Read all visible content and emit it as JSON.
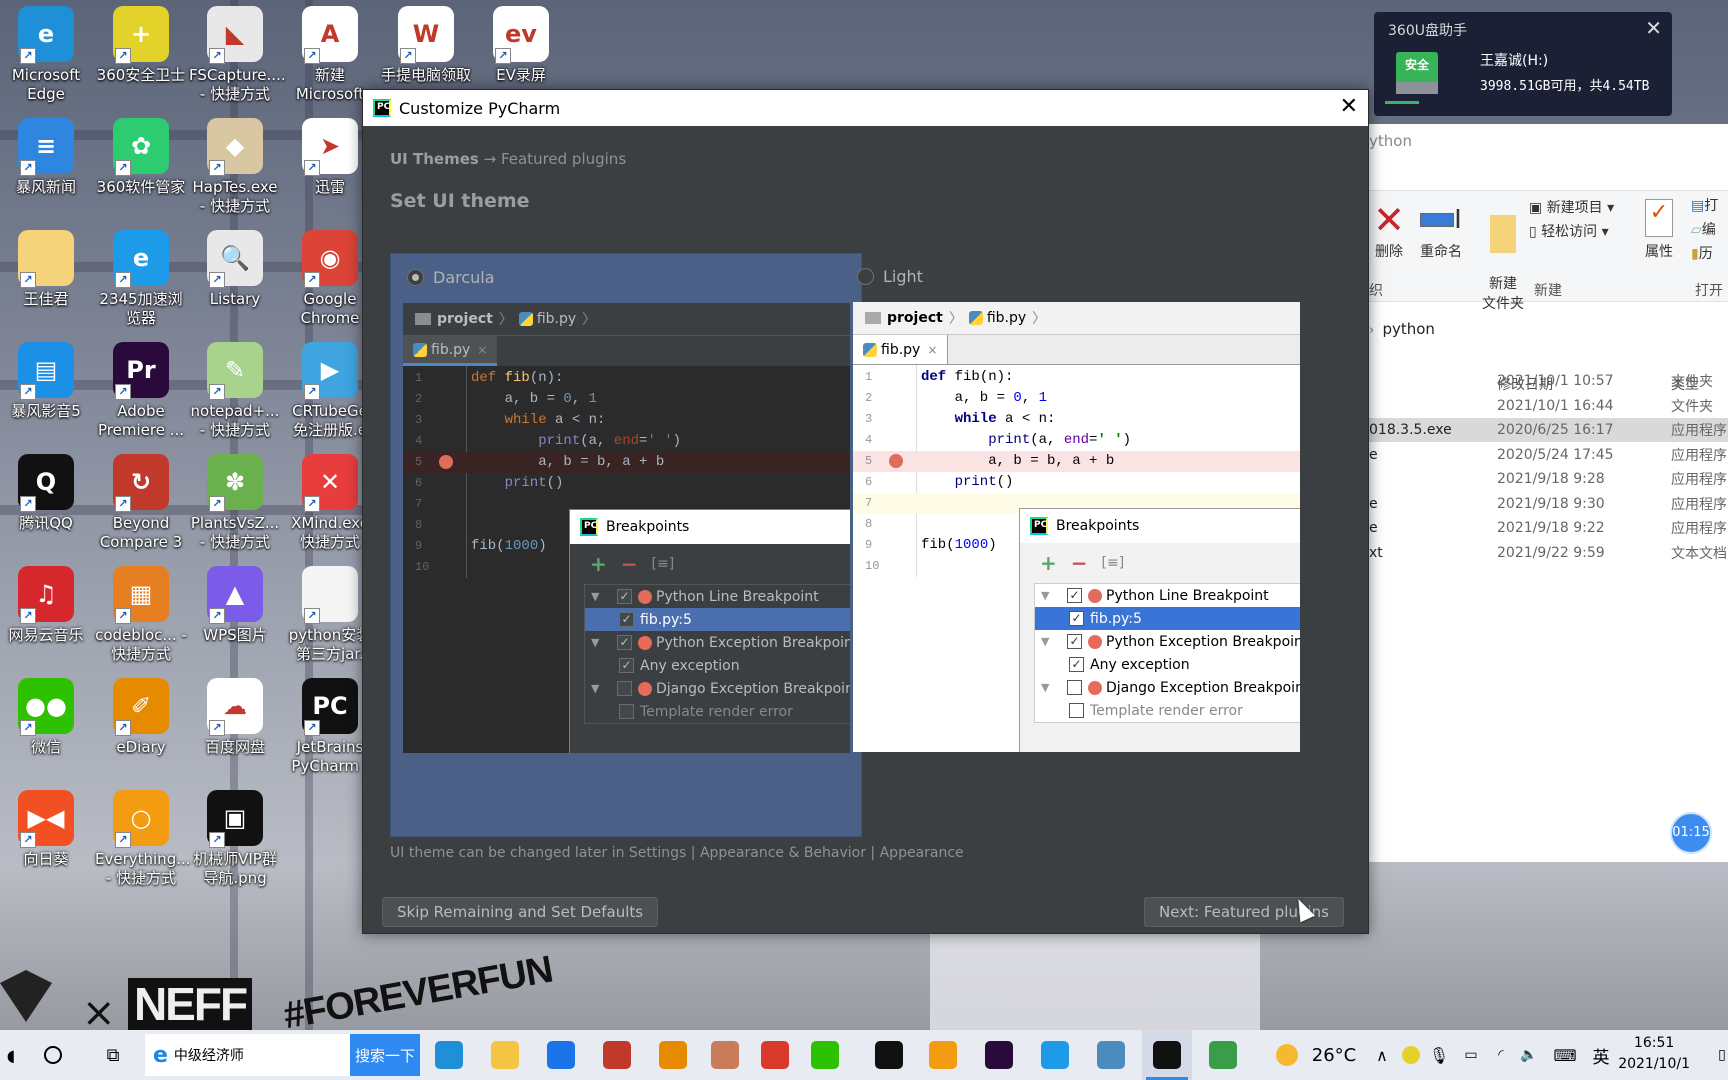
{
  "desktop": {
    "icons": [
      {
        "label": "Microsoft Edge",
        "icon": "edge-icon",
        "color": "#1f8fd8",
        "glyph": "e"
      },
      {
        "label": "360安全卫士",
        "icon": "360-safe-icon",
        "color": "#e3d22a",
        "glyph": "+"
      },
      {
        "label": "FSCapture.... - 快捷方式",
        "icon": "fscapture-icon",
        "color": "#e8e8e8",
        "glyph": "◣"
      },
      {
        "label": "新建 Microsoft",
        "icon": "access-file-icon",
        "color": "#ffffff",
        "glyph": "A"
      },
      {
        "label": "手提电脑领取",
        "icon": "word-doc-icon",
        "color": "#ffffff",
        "glyph": "W"
      },
      {
        "label": "EV录屏",
        "icon": "ev-recorder-icon",
        "color": "#ffffff",
        "glyph": "ev"
      },
      {
        "label": "暴风新闻",
        "icon": "baofeng-news-icon",
        "color": "#2e86de",
        "glyph": "≡"
      },
      {
        "label": "360软件管家",
        "icon": "360-software-icon",
        "color": "#2ecc71",
        "glyph": "✿"
      },
      {
        "label": "HapTes.exe - 快捷方式",
        "icon": "haptes-icon",
        "color": "#d9c7a3",
        "glyph": "◆"
      },
      {
        "label": "迅雷",
        "icon": "xunlei-icon",
        "color": "#ffffff",
        "glyph": "➤"
      },
      {
        "label": "王佳君",
        "icon": "folder-icon",
        "color": "#f4d37a",
        "glyph": ""
      },
      {
        "label": "2345加速浏览器",
        "icon": "2345-browser-icon",
        "color": "#1e9be8",
        "glyph": "e"
      },
      {
        "label": "Listary",
        "icon": "listary-icon",
        "color": "#e8e8e8",
        "glyph": "🔍"
      },
      {
        "label": "Google Chrome",
        "icon": "chrome-icon",
        "color": "#db4437",
        "glyph": "◉"
      },
      {
        "label": "暴风影音5",
        "icon": "baofeng-player-icon",
        "color": "#1c8fe6",
        "glyph": "▤"
      },
      {
        "label": "Adobe Premiere ...",
        "icon": "premiere-icon",
        "color": "#2a0a3a",
        "glyph": "Pr"
      },
      {
        "label": "notepad+... - 快捷方式",
        "icon": "notepadpp-icon",
        "color": "#a8d38c",
        "glyph": "✎"
      },
      {
        "label": "CRTubeGe 免注册版.e",
        "icon": "crtube-icon",
        "color": "#3fa4e0",
        "glyph": "▶"
      },
      {
        "label": "腾讯QQ",
        "icon": "qq-icon",
        "color": "#111111",
        "glyph": "Q"
      },
      {
        "label": "Beyond Compare 3",
        "icon": "beyond-compare-icon",
        "color": "#c0392b",
        "glyph": "↻"
      },
      {
        "label": "PlantsVsZ... - 快捷方式",
        "icon": "pvz-icon",
        "color": "#6ab04c",
        "glyph": "✽"
      },
      {
        "label": "XMind.exe 快捷方式",
        "icon": "xmind-icon",
        "color": "#e83d3d",
        "glyph": "✕"
      },
      {
        "label": "网易云音乐",
        "icon": "netease-music-icon",
        "color": "#d6282c",
        "glyph": "♫"
      },
      {
        "label": "codebloc... - 快捷方式",
        "icon": "codeblocks-icon",
        "color": "#e67e22",
        "glyph": "▦"
      },
      {
        "label": "WPS图片",
        "icon": "wps-pic-icon",
        "color": "#7b5ce8",
        "glyph": "▲"
      },
      {
        "label": "python安装 第三方jar.",
        "icon": "text-file-icon",
        "color": "#f5f5f5",
        "glyph": ""
      },
      {
        "label": "微信",
        "icon": "wechat-icon",
        "color": "#2dc100",
        "glyph": "●●"
      },
      {
        "label": "eDiary",
        "icon": "ediary-icon",
        "color": "#e68a00",
        "glyph": "✐"
      },
      {
        "label": "百度网盘",
        "icon": "baidu-pan-icon",
        "color": "#ffffff",
        "glyph": "☁"
      },
      {
        "label": "JetBrains PyCharm .",
        "icon": "pycharm-icon",
        "color": "#111111",
        "glyph": "PC"
      },
      {
        "label": "向日葵",
        "icon": "sunlogin-icon",
        "color": "#f25022",
        "glyph": "▶◀"
      },
      {
        "label": "Everything... - 快捷方式",
        "icon": "everything-icon",
        "color": "#f39c12",
        "glyph": "○"
      },
      {
        "label": "机械师VIP群 导航.png",
        "icon": "image-file-icon",
        "color": "#111111",
        "glyph": "▣"
      }
    ],
    "wallpaper_text": {
      "brand_x": "×",
      "brand": "NEFF",
      "hashtag": "#FOREVERFUN"
    }
  },
  "dialog": {
    "title": "Customize PyCharm",
    "breadcrumb_current": "UI Themes",
    "breadcrumb_arrow": "→",
    "breadcrumb_next": "Featured plugins",
    "heading": "Set UI theme",
    "themes": [
      {
        "name": "Darcula",
        "selected": true
      },
      {
        "name": "Light",
        "selected": false
      }
    ],
    "preview": {
      "nav_project": "project",
      "nav_file": "fib.py",
      "tab_file": "fib.py",
      "tab_close": "×",
      "line_numbers": [
        "1",
        "2",
        "3",
        "4",
        "5",
        "6",
        "7",
        "8",
        "9",
        "10"
      ],
      "code": {
        "l1_kw": "def",
        "l1_fn": "fib",
        "l1_rest": "(n):",
        "l2_a": "    a, b = ",
        "l2_n0": "0",
        "l2_c": ", ",
        "l2_n1": "1",
        "l3_kw": "    while",
        "l3_rest": " a < n:",
        "l4_bi": "        print",
        "l4_a": "(a, ",
        "l4_kw": "end",
        "l4_eq": "=",
        "l4_str": "' '",
        "l4_end": ")",
        "l5": "        a, b = b, a + b",
        "l6_bi": "    print",
        "l6_rest": "()",
        "l9_a": "fib(",
        "l9_num": "1000",
        "l9_b": ")"
      },
      "breakpoint_line": 5,
      "breakpoints_window": {
        "title": "Breakpoints",
        "add": "+",
        "remove": "−",
        "copy": "[≡]",
        "items": [
          {
            "label": "Python Line Breakpoint",
            "checked": true,
            "level": 0,
            "expander": "▼"
          },
          {
            "label": "fib.py:5",
            "checked": true,
            "level": 1,
            "selected": true
          },
          {
            "label": "Python Exception Breakpoint",
            "checked": true,
            "level": 0,
            "expander": "▼"
          },
          {
            "label": "Any exception",
            "checked": true,
            "level": 1
          },
          {
            "label": "Django Exception Breakpoint",
            "checked": false,
            "level": 0,
            "expander": "▼"
          },
          {
            "label": "Template render error",
            "checked": false,
            "level": 1
          }
        ]
      }
    },
    "hint": "UI theme can be changed later in Settings | Appearance & Behavior | Appearance",
    "skip_button": "Skip Remaining and Set Defaults",
    "next_button": "Next: Featured plugins",
    "close": "✕"
  },
  "usb_popup": {
    "title": "360U盘助手",
    "badge": "安全",
    "drive_name": "王嘉诚(H:)",
    "capacity": "3998.51GB可用，共4.54TB",
    "close": "✕"
  },
  "explorer": {
    "title_partial": "ython",
    "ribbon": {
      "delete": "删除",
      "rename": "重命名",
      "new_folder": "新建\n文件夹",
      "new_item": "新建项目 ▾",
      "easy_access": "轻松访问 ▾",
      "properties": "属性",
      "open_partial": "打",
      "edit_partial": "编",
      "history_partial": "历",
      "group_organize_partial": "织",
      "group_new": "新建",
      "group_open": "打开"
    },
    "address": "python",
    "columns": {
      "modified": "修改日期",
      "type": "类型"
    },
    "rows": [
      {
        "name": "",
        "modified": "2021/10/1 10:57",
        "type": "文件夹"
      },
      {
        "name": "",
        "modified": "2021/10/1 16:44",
        "type": "文件夹"
      },
      {
        "name": "018.3.5.exe",
        "modified": "2020/6/25 16:17",
        "type": "应用程序",
        "highlight": true
      },
      {
        "name": "e",
        "modified": "2020/5/24 17:45",
        "type": "应用程序"
      },
      {
        "name": "",
        "modified": "2021/9/18 9:28",
        "type": "应用程序"
      },
      {
        "name": "e",
        "modified": "2021/9/18 9:30",
        "type": "应用程序"
      },
      {
        "name": "e",
        "modified": "2021/9/18 9:22",
        "type": "应用程序"
      },
      {
        "name": "xt",
        "modified": "2021/9/22 9:59",
        "type": "文本文档"
      }
    ]
  },
  "timer_badge": "01:15",
  "taskbar": {
    "search_text": "中级经济师",
    "search_button": "搜索一下",
    "apps": [
      {
        "name": "edge",
        "color": "#1f8fd8"
      },
      {
        "name": "file-explorer",
        "color": "#f4c542"
      },
      {
        "name": "mail",
        "color": "#1a73e8"
      },
      {
        "name": "beyond-compare",
        "color": "#c0392b"
      },
      {
        "name": "ediary",
        "color": "#e68a00"
      },
      {
        "name": "haptes",
        "color": "#c97b5a"
      },
      {
        "name": "fscapture",
        "color": "#d93a2b"
      },
      {
        "name": "wechat",
        "color": "#2dc100"
      },
      {
        "name": "qq",
        "color": "#111111"
      },
      {
        "name": "everything",
        "color": "#f39c12"
      },
      {
        "name": "premiere",
        "color": "#2a0a3a"
      },
      {
        "name": "2345-browser",
        "color": "#1e9be8"
      },
      {
        "name": "python-file",
        "color": "#4b8bbe"
      },
      {
        "name": "pycharm",
        "color": "#111111",
        "active": true
      },
      {
        "name": "usb-drive",
        "color": "#3a9d4a"
      }
    ],
    "weather": "26°C",
    "tray_chevron": "∧",
    "ime": "英",
    "time": "16:51",
    "date": "2021/10/1"
  }
}
